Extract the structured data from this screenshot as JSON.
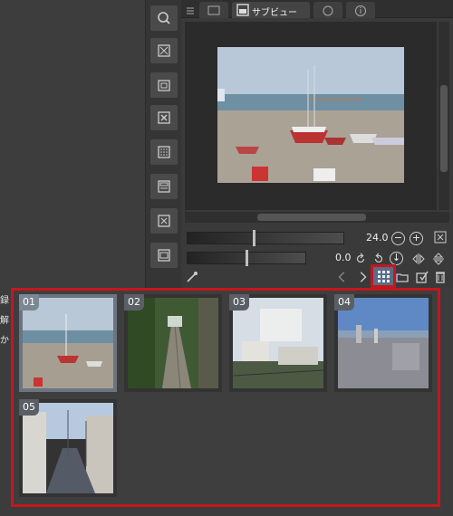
{
  "left_panel": {
    "snippet_lines": [
      "録",
      "解",
      "か"
    ]
  },
  "toolstrip": {
    "icons": [
      "navigator-icon",
      "add-layer-icon",
      "layer-folder-icon",
      "delete-icon",
      "tone-icon",
      "frame-icon",
      "expand-icon",
      "window-icon"
    ]
  },
  "subview": {
    "tabs": [
      {
        "name": "layer-tab-icon",
        "label": ""
      },
      {
        "name": "subview-tab",
        "label": "サブビュー"
      },
      {
        "name": "search-tab-icon",
        "label": ""
      },
      {
        "name": "info-tab-icon",
        "label": ""
      }
    ],
    "active_tab_label": "サブビュー",
    "controls": {
      "zoom_value": "24.0",
      "rotate_value": "0.0"
    }
  },
  "thumbnails": [
    {
      "index": "01",
      "selected": true
    },
    {
      "index": "02",
      "selected": false
    },
    {
      "index": "03",
      "selected": false
    },
    {
      "index": "04",
      "selected": false
    },
    {
      "index": "05",
      "selected": false
    }
  ],
  "colors": {
    "highlight_red": "#c7161b",
    "selected_thumb": "#6b7480",
    "grid_button_bg": "#5b6c86"
  }
}
